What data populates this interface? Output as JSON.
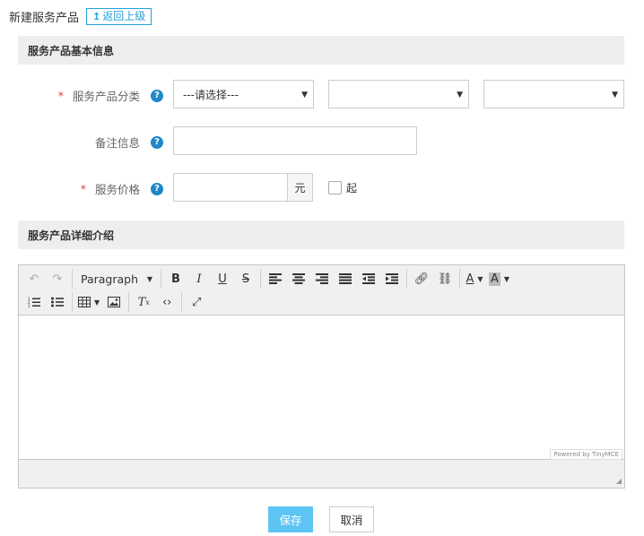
{
  "header": {
    "title": "新建服务产品",
    "back_label": "返回上级"
  },
  "sections": {
    "basic_info": "服务产品基本信息",
    "detail": "服务产品详细介绍"
  },
  "form": {
    "category": {
      "required_mark": "*",
      "label": "服务产品分类",
      "help": "?",
      "select1_value": "---请选择---",
      "select2_value": "",
      "select3_value": ""
    },
    "remark": {
      "label": "备注信息",
      "help": "?",
      "value": ""
    },
    "price": {
      "required_mark": "*",
      "label": "服务价格",
      "help": "?",
      "value": "",
      "unit": "元",
      "from_label": "起",
      "from_checked": false
    }
  },
  "editor": {
    "format_label": "Paragraph",
    "powered_by": "Powered by TinyMCE",
    "content": ""
  },
  "actions": {
    "save_label": "保存",
    "cancel_label": "取消"
  },
  "colors": {
    "accent": "#26a0da",
    "save_button": "#5cc5f3",
    "help_icon": "#1e88c7",
    "required": "#e4393c",
    "section_bg": "#eeeeee"
  }
}
